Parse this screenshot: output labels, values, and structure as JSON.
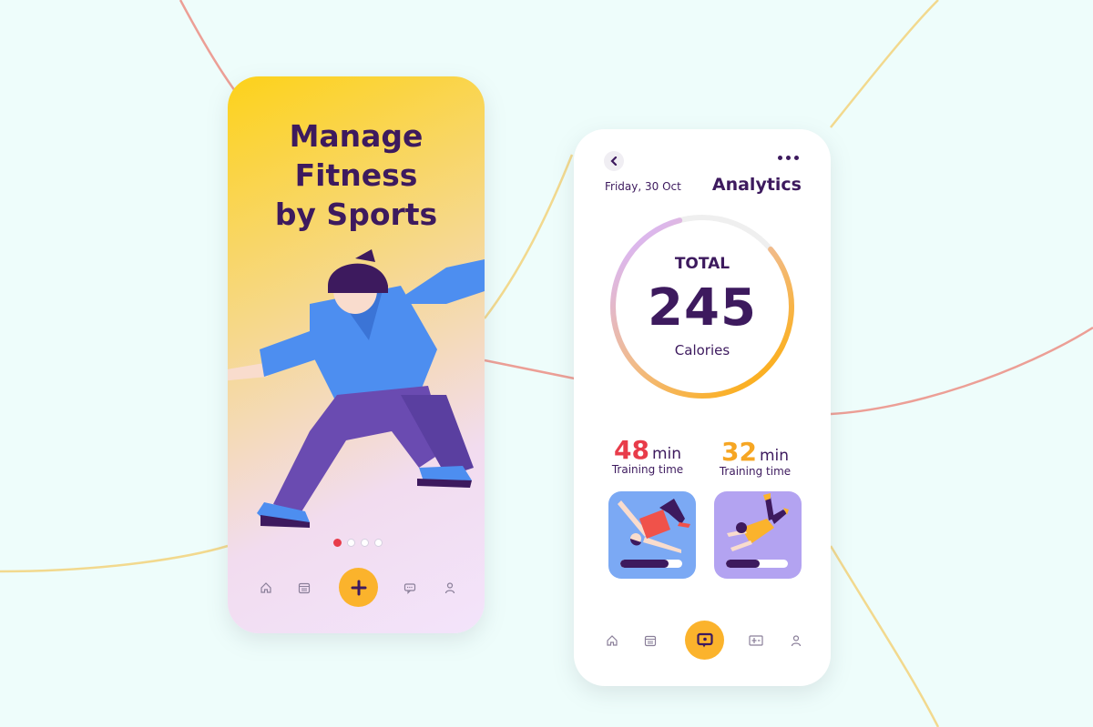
{
  "colors": {
    "background": "#eefdfb",
    "brand_purple": "#3d1a5e",
    "accent_yellow": "#fbb32c",
    "accent_red": "#e83c4a",
    "accent_orange": "#f6a623",
    "card_blue": "#7ba9f4",
    "card_violet": "#b3a3f1"
  },
  "onboarding": {
    "headline_lines": [
      "Manage",
      "Fitness",
      "by Sports"
    ],
    "pager": {
      "total": 4,
      "active_index": 0
    },
    "nav": {
      "items": [
        {
          "icon": "home-icon"
        },
        {
          "icon": "calendar-icon"
        },
        {
          "icon": "plus-icon",
          "primary": true
        },
        {
          "icon": "chat-icon"
        },
        {
          "icon": "profile-icon"
        }
      ]
    }
  },
  "analytics": {
    "back_icon": "chevron-left-icon",
    "more_icon": "more-horizontal-icon",
    "date": "Friday, 30 Oct",
    "title": "Analytics",
    "total": {
      "label": "TOTAL",
      "value": "245",
      "unit": "Calories",
      "progress_fraction": 0.82
    },
    "stats": [
      {
        "value": "48",
        "unit": "min",
        "label": "Training time",
        "color": "#e83c4a",
        "progress_fraction": 0.78
      },
      {
        "value": "32",
        "unit": "min",
        "label": "Training time",
        "color": "#f6a623",
        "progress_fraction": 0.55
      }
    ],
    "nav": {
      "items": [
        {
          "icon": "home-icon"
        },
        {
          "icon": "calendar-icon"
        },
        {
          "icon": "message-icon",
          "primary": true
        },
        {
          "icon": "stats-board-icon"
        },
        {
          "icon": "profile-icon"
        }
      ]
    }
  }
}
